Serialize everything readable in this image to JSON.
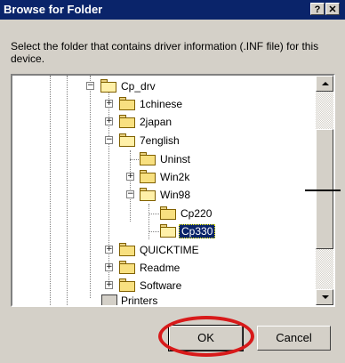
{
  "window": {
    "title": "Browse for Folder",
    "help_glyph": "?",
    "close_glyph": "✕"
  },
  "instruction": "Select the folder that contains driver information (.INF file) for this device.",
  "tree": {
    "nodes": [
      {
        "label": "Cp_drv",
        "expander": "−",
        "open": true
      },
      {
        "label": "1chinese",
        "expander": "+"
      },
      {
        "label": "2japan",
        "expander": "+"
      },
      {
        "label": "7english",
        "expander": "−",
        "open": true
      },
      {
        "label": "Uninst"
      },
      {
        "label": "Win2k",
        "expander": "+"
      },
      {
        "label": "Win98",
        "expander": "−",
        "open": true
      },
      {
        "label": "Cp220"
      },
      {
        "label": "Cp330",
        "selected": true
      },
      {
        "label": "QUICKTIME",
        "expander": "+"
      },
      {
        "label": "Readme",
        "expander": "+"
      },
      {
        "label": "Software",
        "expander": "+"
      },
      {
        "label": "Printers"
      }
    ]
  },
  "buttons": {
    "ok": "OK",
    "cancel": "Cancel"
  },
  "colors": {
    "title_bar": "#0a246a",
    "annotation": "#d81a1a"
  }
}
